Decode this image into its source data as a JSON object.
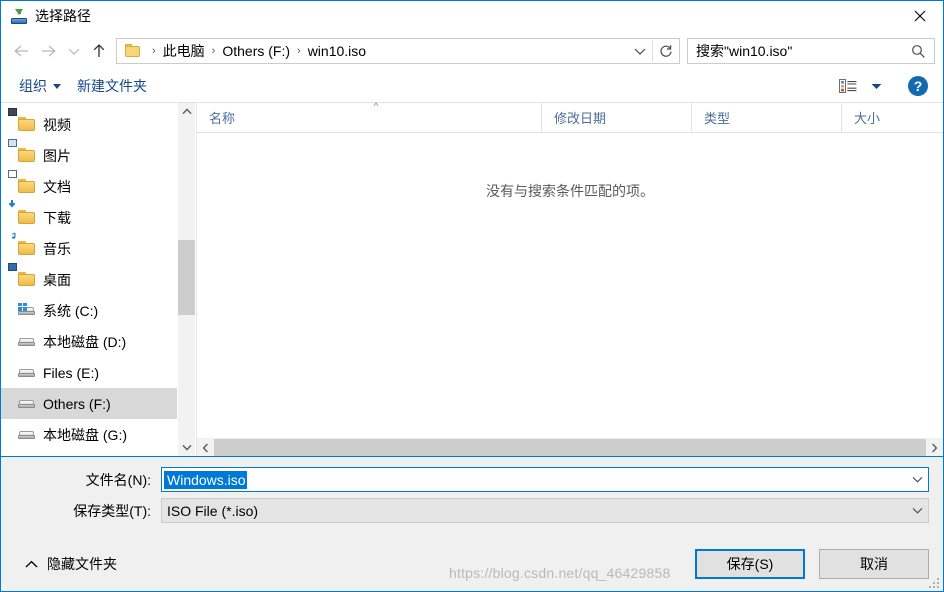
{
  "window": {
    "title": "选择路径",
    "icon": "save-dialog-icon",
    "close_label": "✕"
  },
  "nav": {
    "back_icon": "arrow-left-icon",
    "forward_icon": "arrow-right-icon",
    "recent_icon": "chevron-down-icon",
    "up_icon": "arrow-up-icon",
    "refresh_icon": "refresh-icon",
    "address_chevron": "chevron-down-icon",
    "breadcrumb": [
      "此电脑",
      "Others (F:)",
      "win10.iso"
    ],
    "separator": "›"
  },
  "search": {
    "value": "搜索\"win10.iso\"",
    "icon": "search-icon"
  },
  "toolbar": {
    "organize_label": "组织",
    "new_folder_label": "新建文件夹",
    "view_icon": "view-options-icon",
    "view_caret_icon": "chevron-down-icon",
    "help_label": "?",
    "help_icon": "help-icon"
  },
  "sidebar": {
    "items": [
      {
        "label": "视频",
        "icon": "folder-video-icon",
        "type": "folder",
        "variant": "film",
        "selected": false
      },
      {
        "label": "图片",
        "icon": "folder-pictures-icon",
        "type": "folder",
        "variant": "pic",
        "selected": false
      },
      {
        "label": "文档",
        "icon": "folder-documents-icon",
        "type": "folder",
        "variant": "doc",
        "selected": false
      },
      {
        "label": "下载",
        "icon": "folder-downloads-icon",
        "type": "folder",
        "variant": "dl",
        "selected": false
      },
      {
        "label": "音乐",
        "icon": "folder-music-icon",
        "type": "folder",
        "variant": "music",
        "selected": false
      },
      {
        "label": "桌面",
        "icon": "folder-desktop-icon",
        "type": "folder",
        "variant": "desk",
        "selected": false
      },
      {
        "label": "系统 (C:)",
        "icon": "drive-system-icon",
        "type": "drive",
        "variant": "windows",
        "selected": false
      },
      {
        "label": "本地磁盘 (D:)",
        "icon": "drive-icon",
        "type": "drive",
        "variant": "plain",
        "selected": false
      },
      {
        "label": "Files (E:)",
        "icon": "drive-icon",
        "type": "drive",
        "variant": "plain",
        "selected": false
      },
      {
        "label": "Others (F:)",
        "icon": "drive-icon",
        "type": "drive",
        "variant": "plain",
        "selected": true
      },
      {
        "label": "本地磁盘 (G:)",
        "icon": "drive-icon",
        "type": "drive",
        "variant": "plain",
        "selected": false
      }
    ],
    "scroll_up_icon": "chevron-up-icon",
    "scroll_down_icon": "chevron-down-icon"
  },
  "filelist": {
    "columns": [
      {
        "label": "名称",
        "key": "name"
      },
      {
        "label": "修改日期",
        "key": "date"
      },
      {
        "label": "类型",
        "key": "type"
      },
      {
        "label": "大小",
        "key": "size"
      }
    ],
    "sort_indicator": "^",
    "rows": [],
    "empty_message": "没有与搜索条件匹配的项。",
    "hscroll_left_icon": "chevron-left-icon",
    "hscroll_right_icon": "chevron-right-icon"
  },
  "form": {
    "filename_label": "文件名(N):",
    "filename_value": "Windows.iso",
    "filename_chevron": "chevron-down-icon",
    "savetype_label": "保存类型(T):",
    "savetype_value": "ISO File (*.iso)",
    "savetype_chevron": "chevron-down-icon"
  },
  "footer": {
    "hide_folders_label": "隐藏文件夹",
    "hide_folders_icon": "chevron-up-icon",
    "save_label": "保存(S)",
    "cancel_label": "取消",
    "watermark": "https://blog.csdn.net/qq_46429858",
    "resize_grip_icon": "resize-grip-icon"
  },
  "colors": {
    "accent": "#0078d7",
    "selection": "#0078d7",
    "column_header_text": "#4a6f9b",
    "toolbar_text": "#17478a"
  }
}
